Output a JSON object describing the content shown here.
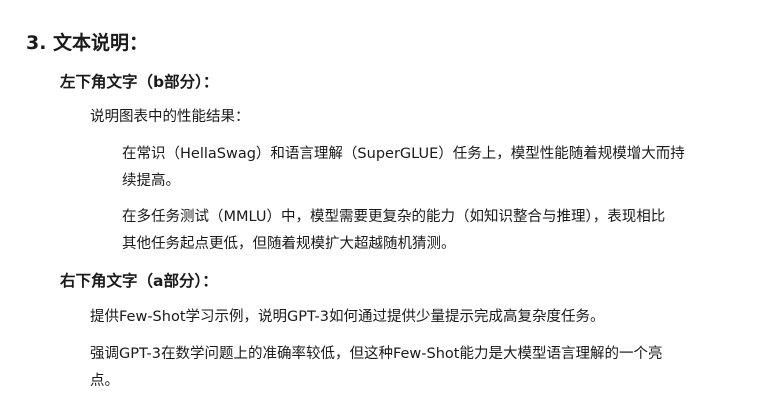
{
  "section": {
    "title": "3. 文本说明："
  },
  "lower_left": {
    "heading": "左下角文字（b部分）：",
    "intro": "说明图表中的性能结果：",
    "items": [
      {
        "line1": "在常识（HellaSwag）和语言理解（SuperGLUE）任务上，模型性能随着规模增大而持",
        "line2": "续提高。"
      },
      {
        "line1": "在多任务测试（MMLU）中，模型需要更复杂的能力（如知识整合与推理），表现相比",
        "line2": "其他任务起点更低，但随着规模扩大超越随机猜测。"
      }
    ]
  },
  "lower_right": {
    "heading": "右下角文字（a部分）：",
    "items": [
      {
        "line1": "提供Few-Shot学习示例，说明GPT-3如何通过提供少量提示完成高复杂度任务。"
      },
      {
        "line1": "强调GPT-3在数学问题上的准确率较低，但这种Few-Shot能力是大模型语言理解的一个亮",
        "line2": "点。"
      }
    ]
  }
}
